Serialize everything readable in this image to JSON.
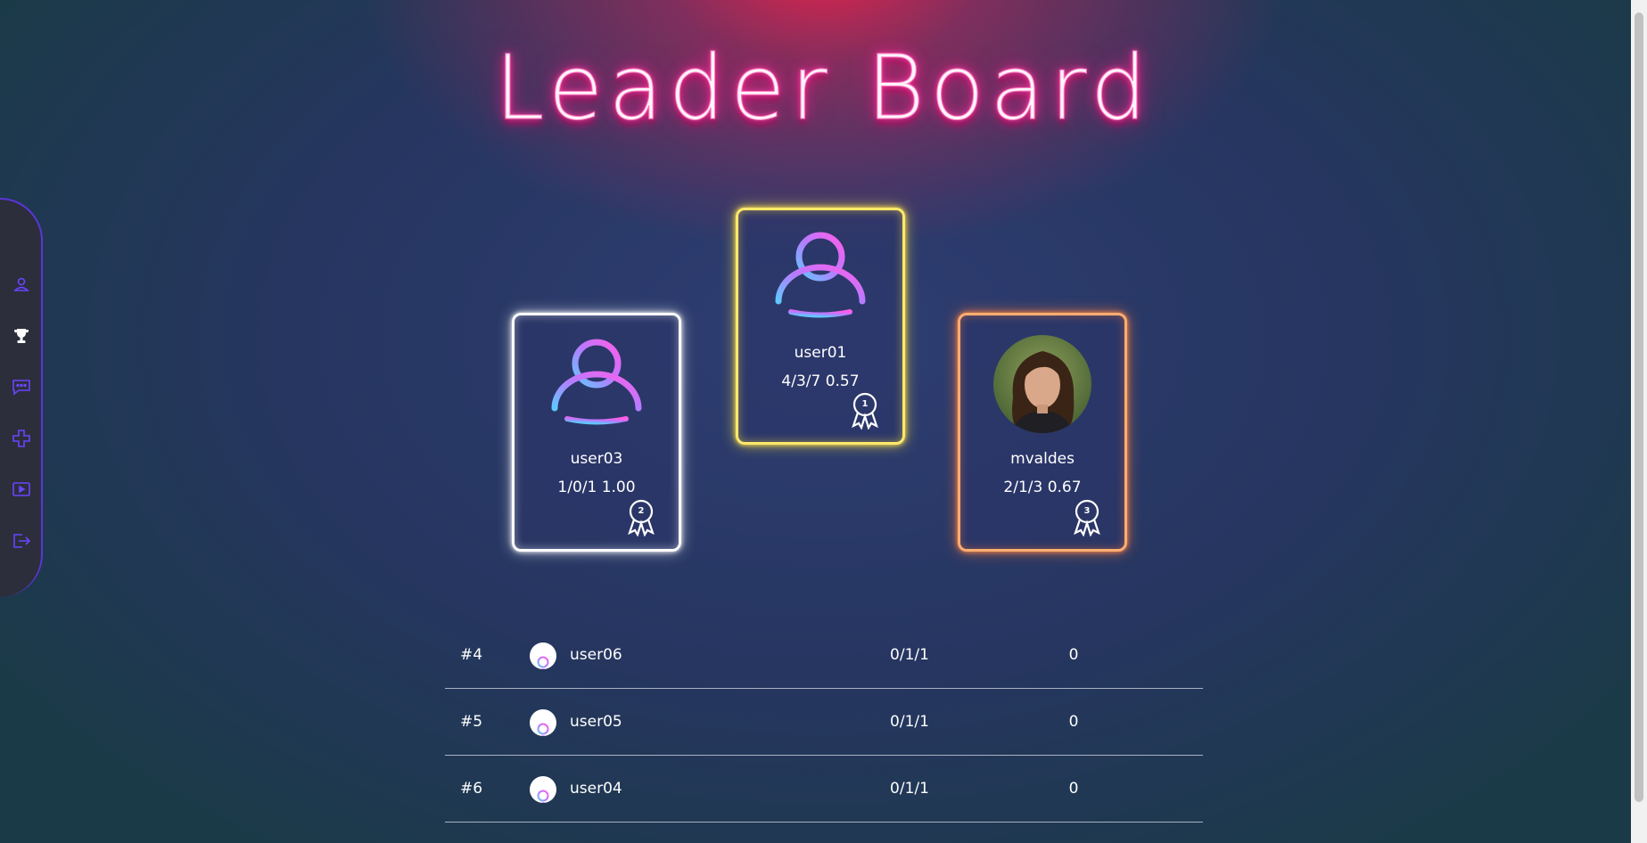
{
  "page": {
    "title": "Leader Board"
  },
  "sidebar": {
    "items": [
      {
        "icon": "profile-icon",
        "active": false
      },
      {
        "icon": "trophy-icon",
        "active": true
      },
      {
        "icon": "chat-icon",
        "active": false
      },
      {
        "icon": "gamepad-icon",
        "active": false
      },
      {
        "icon": "video-icon",
        "active": false
      },
      {
        "icon": "logout-icon",
        "active": false
      }
    ]
  },
  "podium": {
    "first": {
      "rank": "1",
      "name": "user01",
      "score": "4/3/7 0.57",
      "border_color": "#ffe96a"
    },
    "second": {
      "rank": "2",
      "name": "user03",
      "score": "1/0/1 1.00",
      "border_color": "#ffffff"
    },
    "third": {
      "rank": "3",
      "name": "mvaldes",
      "score": "2/1/3 0.67",
      "border_color": "#ffae70"
    }
  },
  "ranking": {
    "rows": [
      {
        "rank": "#4",
        "name": "user06",
        "record": "0/1/1",
        "value": "0"
      },
      {
        "rank": "#5",
        "name": "user05",
        "record": "0/1/1",
        "value": "0"
      },
      {
        "rank": "#6",
        "name": "user04",
        "record": "0/1/1",
        "value": "0"
      }
    ]
  },
  "colors": {
    "accent": "#5b35d8",
    "title_glow": "#ff2d95",
    "avatar_gradient": [
      "#5fc8ff",
      "#b67bff",
      "#ff5de8"
    ]
  }
}
